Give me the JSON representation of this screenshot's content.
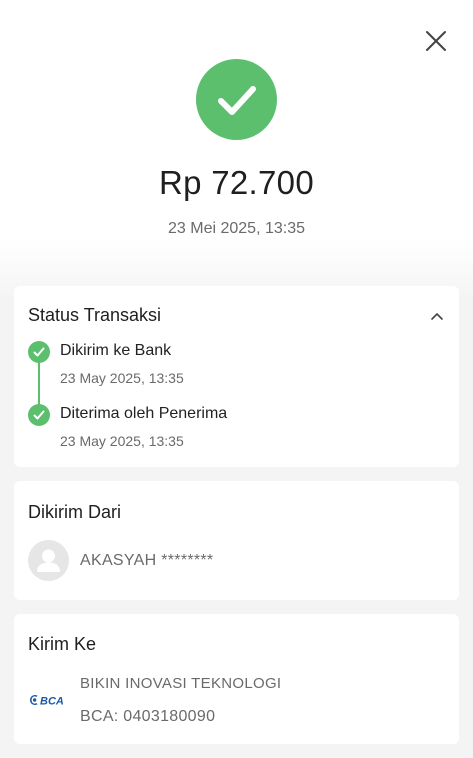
{
  "header": {
    "close_icon": "close-icon",
    "status_icon": "success-check-icon",
    "status_color": "#5cbf6e",
    "amount": "Rp 72.700",
    "datetime": "23 Mei 2025, 13:35"
  },
  "status_section": {
    "title": "Status Transaksi",
    "toggle_icon": "chevron-up-icon",
    "steps": [
      {
        "label": "Dikirim ke Bank",
        "time": "23 May 2025, 13:35",
        "done": true
      },
      {
        "label": "Diterima oleh Penerima",
        "time": "23 May 2025, 13:35",
        "done": true
      }
    ]
  },
  "from_section": {
    "title": "Dikirim Dari",
    "avatar_icon": "user-avatar-icon",
    "sender_name": "AKASYAH ********"
  },
  "to_section": {
    "title": "Kirim Ke",
    "bank_logo": "BCA",
    "bank_color": "#1c5aa7",
    "recipient_name": "BIKIN INOVASI TEKNOLOGI",
    "account": "BCA: 0403180090"
  }
}
